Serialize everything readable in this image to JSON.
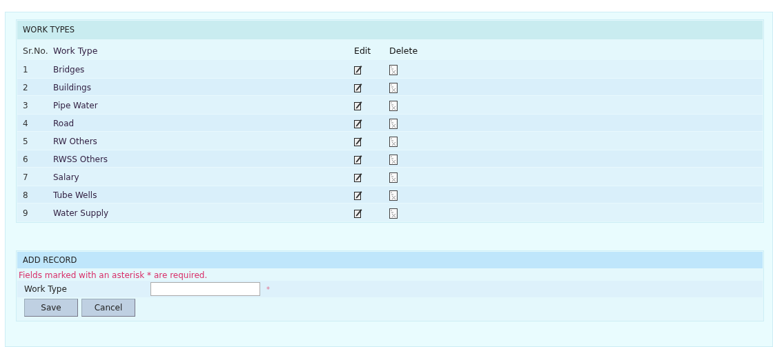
{
  "work_types": {
    "title": "WORK TYPES",
    "columns": [
      "Sr.No.",
      "Work Type",
      "Edit",
      "Delete"
    ],
    "rows": [
      {
        "sr": "1",
        "work_type": "Bridges"
      },
      {
        "sr": "2",
        "work_type": "Buildings"
      },
      {
        "sr": "3",
        "work_type": "Pipe Water"
      },
      {
        "sr": "4",
        "work_type": "Road"
      },
      {
        "sr": "5",
        "work_type": "RW Others"
      },
      {
        "sr": "6",
        "work_type": "RWSS Others"
      },
      {
        "sr": "7",
        "work_type": "Salary"
      },
      {
        "sr": "8",
        "work_type": "Tube Wells"
      },
      {
        "sr": "9",
        "work_type": "Water Supply"
      }
    ]
  },
  "add_record": {
    "title": "ADD RECORD",
    "note": "Fields marked with an asterisk * are required.",
    "field_label": "Work Type",
    "required_mark": "*",
    "buttons": [
      "Save",
      "Cancel"
    ]
  }
}
